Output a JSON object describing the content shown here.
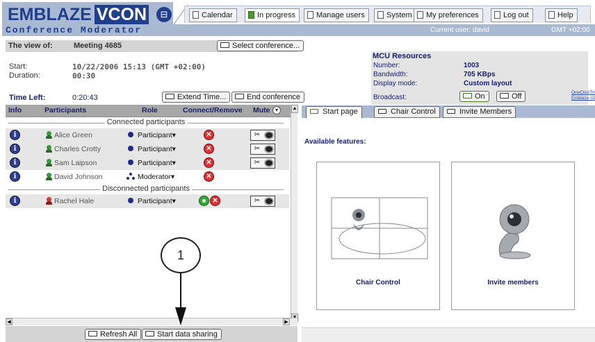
{
  "header": {
    "logo_main": "EMBLAZE",
    "logo_brand": "VCON",
    "subtitle": "Conference Moderator",
    "current_user": "Current user: david",
    "timezone": "GMT +02:00"
  },
  "nav_tabs": [
    {
      "label": "Calendar",
      "active": false
    },
    {
      "label": "In progress",
      "active": true
    },
    {
      "label": "Manage users",
      "active": false
    },
    {
      "label": "System",
      "active": false
    },
    {
      "label": "My preferences",
      "active": false
    },
    {
      "label": "Log out",
      "active": false
    },
    {
      "label": "Help",
      "active": false
    }
  ],
  "conference": {
    "view_of_label": "The view of:",
    "name": "Meeting 4685",
    "select_button": "Select conference...",
    "start_label": "Start:",
    "start_value": "10/22/2006 15:13 (GMT +02:00)",
    "duration_label": "Duration:",
    "duration_value": "00:30",
    "time_left_label": "Time Left:",
    "time_left_value": "0:20:43",
    "extend_button": "Extend Time...",
    "end_button": "End conference"
  },
  "table": {
    "columns": [
      "Info",
      "Participants",
      "Role",
      "Connect/Remove",
      "Mute"
    ],
    "connected_header": "Connected participants",
    "disconnected_header": "Disconnected participants",
    "connected": [
      {
        "name": "Alice Green",
        "role": "Participant"
      },
      {
        "name": "Charles Crotty",
        "role": "Participant"
      },
      {
        "name": "Sam Laipson",
        "role": "Participant"
      },
      {
        "name": "David Johnson",
        "role": "Moderator"
      }
    ],
    "disconnected": [
      {
        "name": "Rachel Hale",
        "role": "Participant"
      }
    ]
  },
  "bottom_buttons": {
    "refresh": "Refresh All",
    "share": "Start data sharing"
  },
  "callout": {
    "number": "1"
  },
  "mcu": {
    "title": "MCU Resources",
    "number_label": "Number:",
    "number_value": "1003",
    "bandwidth_label": "Bandwidth:",
    "bandwidth_value": "705 KBps",
    "display_label": "Display mode:",
    "display_value": "Custom layout",
    "broadcast_label": "Broadcast:",
    "on_label": "On",
    "off_label": "Off",
    "oneclick_line1": "OneClickTime",
    "oneclick_line2": "Emblaze-VCON"
  },
  "right_tabs": [
    "Start page",
    "Chair Control",
    "Invite Members"
  ],
  "features": {
    "title": "Available features:",
    "chair_control": "Chair Control",
    "invite_members": "Invite members"
  },
  "colors": {
    "brand_blue": "#1f3f8c",
    "header_bg": "#a9b9d1",
    "column_header_text": "#14216b",
    "remove_red": "#e03030",
    "connect_green": "#38a838"
  }
}
